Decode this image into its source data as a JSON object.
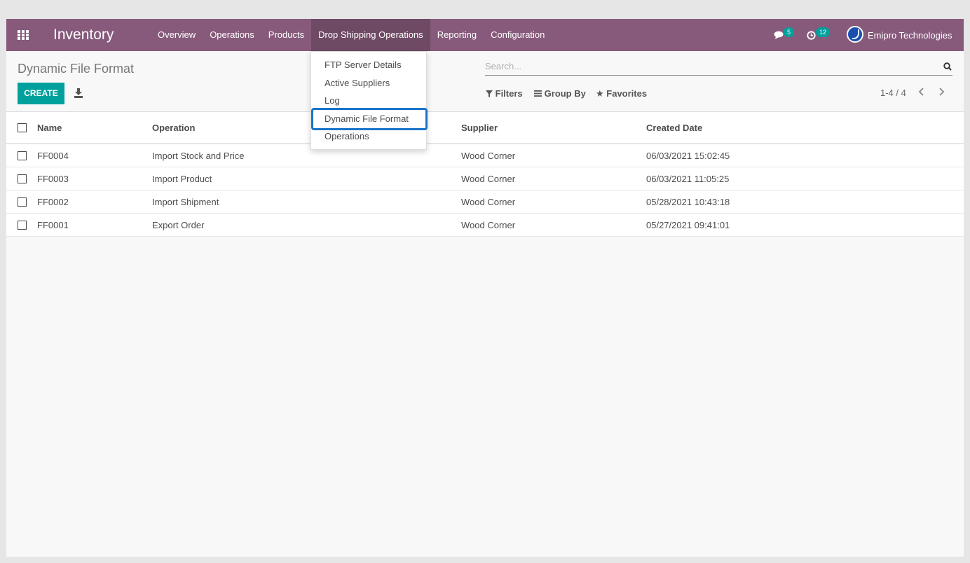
{
  "navbar": {
    "brand": "Inventory",
    "menu": [
      "Overview",
      "Operations",
      "Products",
      "Drop Shipping Operations",
      "Reporting",
      "Configuration"
    ],
    "messages_badge": "5",
    "activities_badge": "12",
    "company": "Emipro Technologies"
  },
  "dropdown": {
    "items": [
      "FTP Server Details",
      "Active Suppliers",
      "Log",
      "Dynamic File Format",
      "Operations"
    ],
    "selected": "Dynamic File Format"
  },
  "control": {
    "breadcrumb": "Dynamic File Format",
    "create_label": "CREATE",
    "search_placeholder": "Search...",
    "filters_label": "Filters",
    "groupby_label": "Group By",
    "favorites_label": "Favorites",
    "pager": "1-4 / 4"
  },
  "table": {
    "headers": [
      "Name",
      "Operation",
      "Supplier",
      "Created Date"
    ],
    "rows": [
      {
        "name": "FF0004",
        "operation": "Import Stock and Price",
        "supplier": "Wood Corner",
        "date": "06/03/2021 15:02:45"
      },
      {
        "name": "FF0003",
        "operation": "Import Product",
        "supplier": "Wood Corner",
        "date": "06/03/2021 11:05:25"
      },
      {
        "name": "FF0002",
        "operation": "Import Shipment",
        "supplier": "Wood Corner",
        "date": "05/28/2021 10:43:18"
      },
      {
        "name": "FF0001",
        "operation": "Export Order",
        "supplier": "Wood Corner",
        "date": "05/27/2021 09:41:01"
      }
    ]
  },
  "colors": {
    "navbar": "#875a7b",
    "primary": "#00a09d",
    "selection": "#1a73c8"
  }
}
